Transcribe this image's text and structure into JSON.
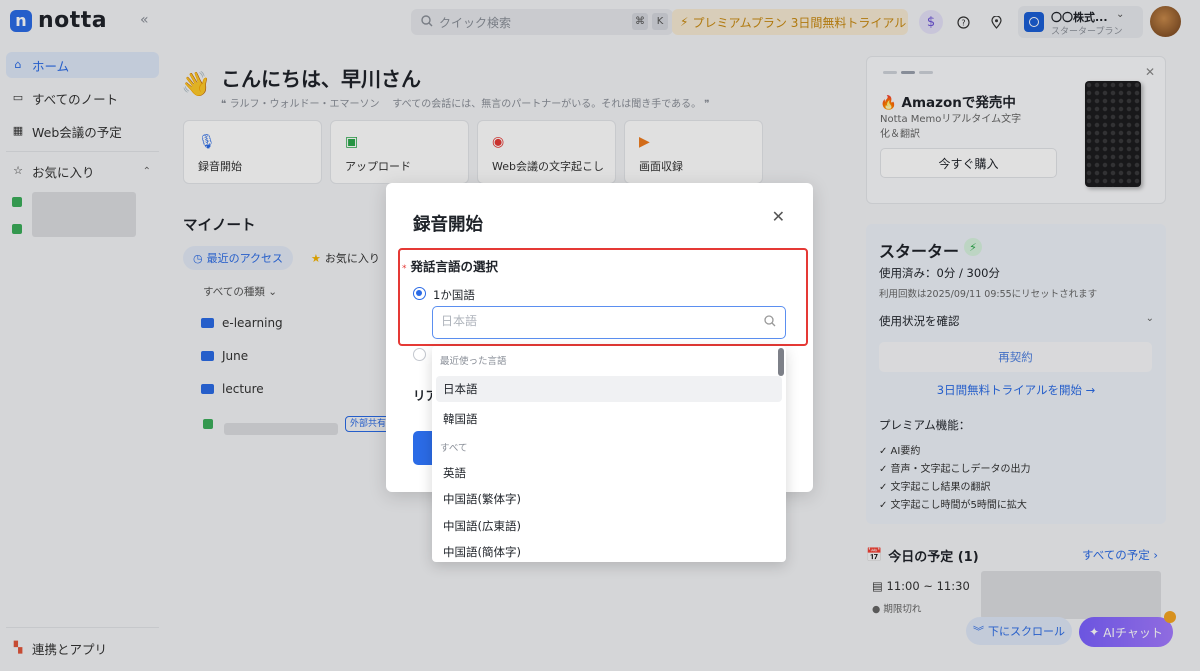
{
  "topbar": {
    "logo_text": "notta",
    "search_placeholder": "クイック検索",
    "kbd_cmd": "⌘",
    "kbd_k": "K",
    "premium_label": "プレミアムプラン 3日間無料トライアル",
    "account_name": "〇〇株式...",
    "account_plan": "スタータープラン"
  },
  "sidebar": {
    "home": "ホーム",
    "all_notes": "すべてのノート",
    "web_meeting": "Web会議の予定",
    "favorites": "お気に入り",
    "integrations": "連携とアプリ"
  },
  "main": {
    "greeting": "こんにちは、早川さん",
    "quote_author": "ラルフ・ウォルドー・エマーソン",
    "quote_text": "すべての会話には、無言のパートナーがいる。それは聞き手である。",
    "quick_actions": [
      "録音開始",
      "アップロード",
      "Web会議の文字起こし",
      "画面収録"
    ],
    "my_notes": "マイノート",
    "chip_recent": "最近のアクセス",
    "chip_fav": "お気に入り",
    "sort_label": "すべての種類",
    "folders": [
      "e-learning",
      "June",
      "lecture"
    ],
    "external_badge": "外部共有"
  },
  "right": {
    "promo_title": "Amazonで発売中",
    "promo_sub": "Notta Memoリアルタイム文字化＆翻訳",
    "buy_label": "今すぐ購入",
    "starter_title": "スターター",
    "usage": "使用済み：0分 / 300分",
    "reset": "利用回数は2025/09/11 09:55にリセットされます",
    "check_usage": "使用状況を確認",
    "renew": "再契約",
    "trial": "3日間無料トライアルを開始 →",
    "premium_head": "プレミアム機能：",
    "premium_features": [
      "✓ AI要約",
      "✓ 音声・文字起こしデータの出力",
      "✓ 文字起こし結果の翻訳",
      "✓ 文字起こし時間が5時間に拡大"
    ],
    "schedule_title": "今日の予定 (1)",
    "schedule_all": "すべての予定 ›",
    "schedule_time": "11:00 ~ 11:30",
    "schedule_status": "期限切れ",
    "scroll_down": "下にスクロール",
    "ai_chat": "AIチャット"
  },
  "modal": {
    "title": "録音開始",
    "lang_label": "発話言語の選択",
    "required_mark": "*",
    "radio_single": "1か国語",
    "lang_placeholder": "日本語",
    "realtime_label": "リア"
  },
  "dropdown": {
    "recent_group": "最近使った言語",
    "recent": [
      "日本語",
      "韓国語"
    ],
    "all_group": "すべて",
    "all": [
      "英語",
      "中国語(繁体字)",
      "中国語(広東語)",
      "中国語(簡体字)"
    ]
  },
  "colors": {
    "accent": "#2b6be6",
    "highlight_border": "#e53935",
    "premium_text": "#c98a11"
  }
}
